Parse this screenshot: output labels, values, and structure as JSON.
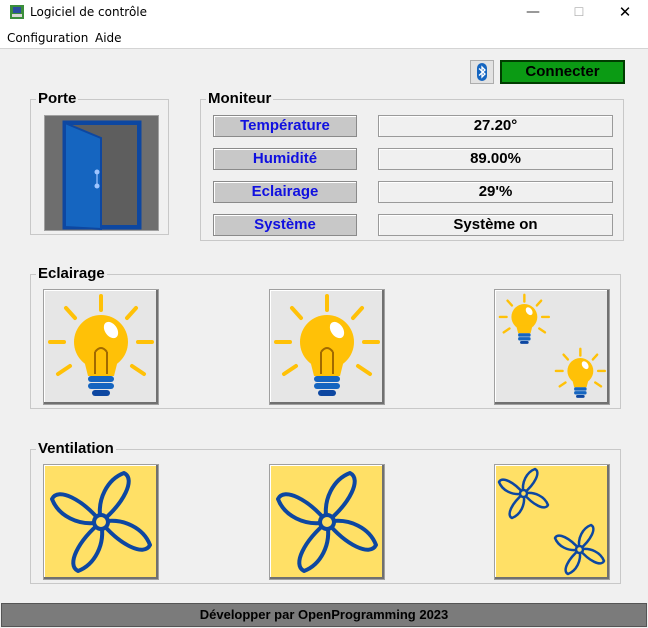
{
  "window": {
    "title": "Logiciel de contrôle",
    "minimize_glyph": "—",
    "maximize_glyph": "☐",
    "close_glyph": "✕"
  },
  "menu": [
    {
      "label": "Configuration"
    },
    {
      "label": "Aide"
    }
  ],
  "toolbar": {
    "bluetooth_icon": "bluetooth-icon",
    "connect_label": "Connecter",
    "connect_color": "#0b9b14"
  },
  "porte": {
    "title": "Porte",
    "icon": "door-open-icon"
  },
  "moniteur": {
    "title": "Moniteur",
    "rows": [
      {
        "label": "Température",
        "value": "27.20°"
      },
      {
        "label": "Humidité",
        "value": "89.00%"
      },
      {
        "label": "Eclairage",
        "value": "29'%"
      },
      {
        "label": "Système",
        "value": "Système on"
      }
    ],
    "label_color": "#1010e0"
  },
  "eclairage": {
    "title": "Eclairage",
    "buttons": [
      {
        "icon": "light-bulb-icon"
      },
      {
        "icon": "light-bulb-icon"
      },
      {
        "icon": "all-lights-icon"
      }
    ]
  },
  "ventilation": {
    "title": "Ventilation",
    "buttons": [
      {
        "icon": "fan-icon"
      },
      {
        "icon": "fan-icon"
      },
      {
        "icon": "all-fans-icon"
      }
    ],
    "fan_color": "#ffe066"
  },
  "status": {
    "text": "Développer par OpenProgramming 2023"
  }
}
